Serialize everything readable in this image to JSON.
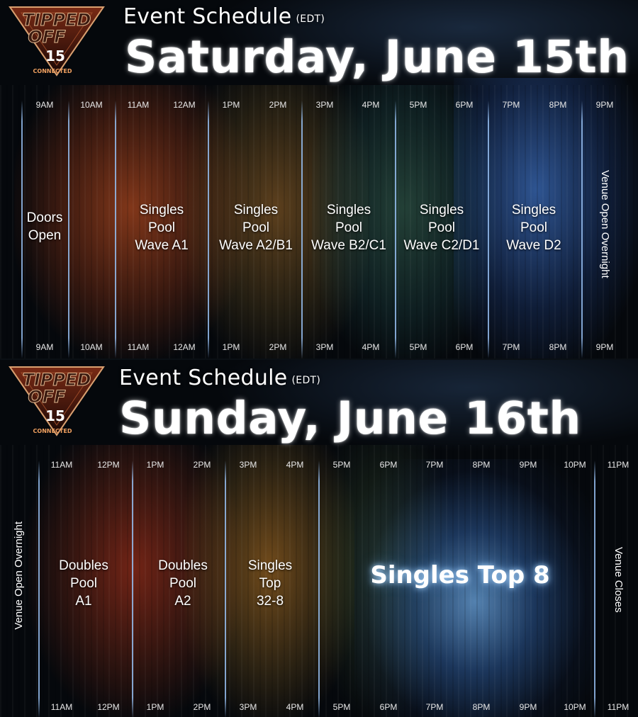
{
  "logo": {
    "line1": "TIPPED",
    "line2": "OFF",
    "number": "15",
    "tagline": "CONNECTED"
  },
  "saturday": {
    "schedule_label": "Event Schedule",
    "timezone": "(EDT)",
    "title": "Saturday, June 15th",
    "hours": [
      "9AM",
      "10AM",
      "11AM",
      "12AM",
      "1PM",
      "2PM",
      "3PM",
      "4PM",
      "5PM",
      "6PM",
      "7PM",
      "8PM",
      "9PM"
    ],
    "blocks": [
      "Doors\nOpen",
      "Singles\nPool\nWave A1",
      "Singles\nPool\nWave A2/B1",
      "Singles\nPool\nWave B2/C1",
      "Singles\nPool\nWave C2/D1",
      "Singles\nPool\nWave D2"
    ],
    "side_note": "Venue Open Overnight"
  },
  "sunday": {
    "schedule_label": "Event Schedule",
    "timezone": "(EDT)",
    "title": "Sunday, June 16th",
    "hours": [
      "11AM",
      "12PM",
      "1PM",
      "2PM",
      "3PM",
      "4PM",
      "5PM",
      "6PM",
      "7PM",
      "8PM",
      "9PM",
      "10PM",
      "11PM"
    ],
    "blocks": [
      "Doubles\nPool\nA1",
      "Doubles\nPool\nA2",
      "Singles\nTop\n32-8"
    ],
    "feature_block": "Singles Top 8",
    "side_note_left": "Venue Open Overnight",
    "side_note_right": "Venue Closes"
  },
  "colors": {
    "accent_orange": "#c8642a",
    "accent_blue": "#4a8fd0",
    "divider": "#96bef0"
  }
}
